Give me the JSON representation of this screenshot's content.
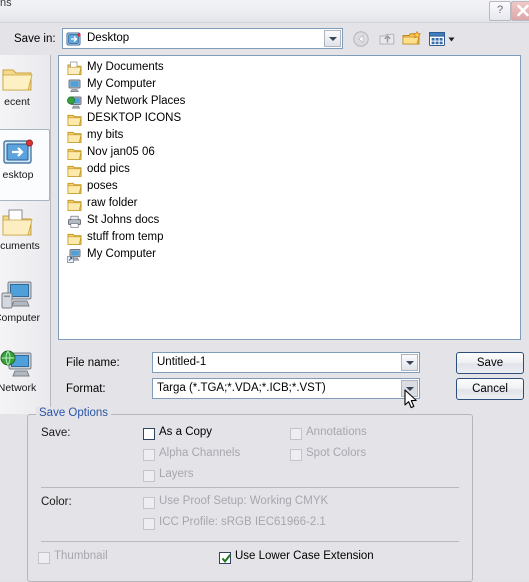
{
  "window": {
    "title_fragment": "ns",
    "help_label": "?",
    "close_label": "✕"
  },
  "toolbar": {
    "savein_label": "Save in:",
    "savein_value": "Desktop",
    "savein_icon": "desktop-icon",
    "buttons": [
      {
        "name": "back-button",
        "icon": "back-arrow-icon",
        "enabled": false
      },
      {
        "name": "up-one-level-button",
        "icon": "up-folder-icon",
        "enabled": false
      },
      {
        "name": "create-new-folder-button",
        "icon": "new-folder-icon",
        "enabled": true
      },
      {
        "name": "views-button",
        "icon": "views-grid-icon",
        "enabled": true
      }
    ]
  },
  "places_bar": {
    "items": [
      {
        "label": "ecent",
        "icon": "recent-folder-icon",
        "selected": false
      },
      {
        "label": "esktop",
        "icon": "desktop-icon",
        "selected": true
      },
      {
        "label": "ocuments",
        "icon": "my-documents-icon",
        "selected": false
      },
      {
        "label": "Computer",
        "icon": "my-computer-icon",
        "selected": false
      },
      {
        "label": "Network",
        "icon": "my-network-places-icon",
        "selected": false
      }
    ]
  },
  "file_list": {
    "items": [
      {
        "name": "My Documents",
        "icon": "my-documents-icon"
      },
      {
        "name": "My Computer",
        "icon": "my-computer-icon"
      },
      {
        "name": "My Network Places",
        "icon": "my-network-places-icon"
      },
      {
        "name": "DESKTOP ICONS",
        "icon": "folder-icon"
      },
      {
        "name": "my bits",
        "icon": "folder-icon"
      },
      {
        "name": "Nov  jan05 06",
        "icon": "folder-icon"
      },
      {
        "name": "odd pics",
        "icon": "folder-icon"
      },
      {
        "name": "poses",
        "icon": "folder-icon"
      },
      {
        "name": "raw folder",
        "icon": "folder-icon"
      },
      {
        "name": "St Johns docs",
        "icon": "printer-shortcut-icon"
      },
      {
        "name": "stuff from temp",
        "icon": "folder-icon"
      },
      {
        "name": "My Computer",
        "icon": "my-computer-shortcut-icon"
      }
    ]
  },
  "fields": {
    "filename_label": "File name:",
    "filename_value": "Untitled-1",
    "format_label": "Format:",
    "format_value": "Targa (*.TGA;*.VDA;*.ICB;*.VST)"
  },
  "actions": {
    "save_label": "Save",
    "cancel_label": "Cancel"
  },
  "save_options": {
    "legend": "Save Options",
    "save_label": "Save:",
    "color_label": "Color:",
    "checkboxes": [
      {
        "label": "As a Copy",
        "checked": false,
        "enabled": true
      },
      {
        "label": "Alpha Channels",
        "checked": false,
        "enabled": false
      },
      {
        "label": "Layers",
        "checked": false,
        "enabled": false
      },
      {
        "label": "Annotations",
        "checked": false,
        "enabled": false
      },
      {
        "label": "Spot Colors",
        "checked": false,
        "enabled": false
      },
      {
        "label": "Use Proof Setup:  Working CMYK",
        "checked": false,
        "enabled": false
      },
      {
        "label": "ICC Profile:  sRGB IEC61966-2.1",
        "checked": false,
        "enabled": false
      },
      {
        "label": "Thumbnail",
        "checked": false,
        "enabled": false
      },
      {
        "label": "Use Lower Case Extension",
        "checked": true,
        "enabled": true
      }
    ]
  },
  "colors": {
    "dialog_bg": "#e4e4e8",
    "panel_bg": "#ffffff",
    "field_border": "#7f9db9",
    "legend_blue": "#2b55a8",
    "disabled_text": "#a6a6ae",
    "check_green": "#1f7a1f",
    "close_red": "#cf6b6b"
  }
}
